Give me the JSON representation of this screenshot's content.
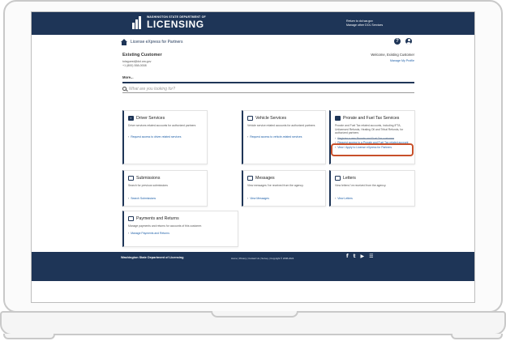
{
  "header": {
    "agency_small": "WASHINGTON STATE DEPARTMENT OF",
    "agency_big": "LICENSING",
    "return_link": "Return to dol.wa.gov",
    "manage_link": "Manage other DOL Services"
  },
  "subheader": {
    "app_title": "License eXpress for Partners",
    "help_glyph": "?"
  },
  "customer": {
    "name": "Existing Customer",
    "email": "tolaguest@dol.wa.gov",
    "phone": "+1 (800) 558-0008"
  },
  "welcome": {
    "text": "Welcome, Existing Customer",
    "profile_link": "Manage My Profile"
  },
  "more_label": "More...",
  "search": {
    "placeholder": "What are you looking for?"
  },
  "cards": {
    "driver": {
      "title": "Driver Services",
      "desc": "Driver services related accounts for authorized partners",
      "link": "Request access to driver-related services"
    },
    "vehicle": {
      "title": "Vehicle Services",
      "desc": "Vehicle service related accounts for authorized partners",
      "link": "Request access to vehicle-related services"
    },
    "prorate": {
      "title": "Prorate and Fuel Tax Services",
      "desc": "Prorate and Fuel Tax related accounts, including IFTA, Unlicensed Refunds, Heating Oil and Tribal Refunds, for authorized partners",
      "link1": "Register a new Prorate and Fuel Tax customer",
      "link2": "Request access to a Prorate and Fuel Tax related account",
      "link3": "View / Apply to License eXpress for Partners"
    },
    "submissions": {
      "title": "Submissions",
      "desc": "Search for previous submissions",
      "link": "Search Submissions"
    },
    "messages": {
      "title": "Messages",
      "desc": "View messages I've received from the agency.",
      "link": "View Messages"
    },
    "letters": {
      "title": "Letters",
      "desc": "View letters I've received from the agency.",
      "link": "View Letters"
    },
    "payments": {
      "title": "Payments and Returns",
      "desc": "Manage payments and returns for accounts of this customer.",
      "link": "Manage Payments and Returns"
    }
  },
  "footer": {
    "org": "Washington State Department of Licensing",
    "links": "Home | Privacy | Contact Us | Survey | Copyright © 2008-2024"
  },
  "icons": {
    "facebook": "f",
    "twitter": "t",
    "youtube": "▶",
    "rss": "☰"
  },
  "colors": {
    "navy": "#1e3557",
    "link": "#1d5fa8",
    "highlight": "#c8502a"
  }
}
